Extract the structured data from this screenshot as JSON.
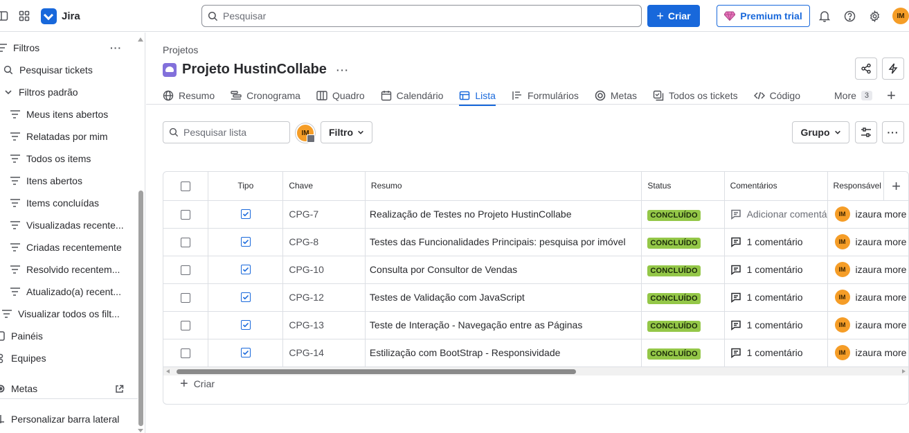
{
  "app": {
    "name": "Jira"
  },
  "topbar": {
    "search_placeholder": "Pesquisar",
    "create_label": "Criar",
    "premium_label": "Premium trial",
    "avatar_initials": "IM"
  },
  "sidebar": {
    "filters_label": "Filtros",
    "items": [
      {
        "label": "Pesquisar tickets",
        "icon": "search-icon"
      },
      {
        "label": "Filtros padrão",
        "icon": "chevron-down-icon"
      },
      {
        "label": "Meus itens abertos",
        "icon": "filter-icon"
      },
      {
        "label": "Relatadas por mim",
        "icon": "filter-icon"
      },
      {
        "label": "Todos os items",
        "icon": "filter-icon"
      },
      {
        "label": "Itens abertos",
        "icon": "filter-icon"
      },
      {
        "label": "Items concluídas",
        "icon": "filter-icon"
      },
      {
        "label": "Visualizadas recente...",
        "icon": "filter-icon"
      },
      {
        "label": "Criadas recentemente",
        "icon": "filter-icon"
      },
      {
        "label": "Resolvido recentem...",
        "icon": "filter-icon"
      },
      {
        "label": "Atualizado(a) recent...",
        "icon": "filter-icon"
      },
      {
        "label": "Visualizar todos os filt...",
        "icon": "filter-icon"
      }
    ],
    "panels_label": "Painéis",
    "teams_label": "Equipes",
    "goals_label": "Metas",
    "customize_label": "Personalizar barra lateral"
  },
  "main": {
    "breadcrumb": "Projetos",
    "project_name": "Projeto HustinCollabe",
    "tabs": [
      {
        "label": "Resumo",
        "icon": "globe-icon"
      },
      {
        "label": "Cronograma",
        "icon": "timeline-icon"
      },
      {
        "label": "Quadro",
        "icon": "board-icon"
      },
      {
        "label": "Calendário",
        "icon": "calendar-icon"
      },
      {
        "label": "Lista",
        "icon": "list-icon",
        "active": true
      },
      {
        "label": "Formulários",
        "icon": "forms-icon"
      },
      {
        "label": "Metas",
        "icon": "goal-icon"
      },
      {
        "label": "Todos os tickets",
        "icon": "tickets-icon"
      },
      {
        "label": "Código",
        "icon": "code-icon"
      }
    ],
    "more_label": "More",
    "more_count": "3",
    "list_search_placeholder": "Pesquisar lista",
    "filter_label": "Filtro",
    "group_label": "Grupo",
    "create_label": "Criar"
  },
  "table": {
    "headers": {
      "type": "Tipo",
      "key": "Chave",
      "summary": "Resumo",
      "status": "Status",
      "comments": "Comentários",
      "assignee": "Responsável"
    },
    "rows": [
      {
        "key": "CPG-7",
        "summary": "Realização de Testes no Projeto HustinCollabe",
        "status": "CONCLUÍDO",
        "comment": "Adicionar comentá",
        "assignee": "izaura more",
        "initials": "IM",
        "empty_comment": true
      },
      {
        "key": "CPG-8",
        "summary": "Testes das Funcionalidades Principais: pesquisa por imóvel",
        "status": "CONCLUÍDO",
        "comment": "1 comentário",
        "assignee": "izaura more",
        "initials": "IM"
      },
      {
        "key": "CPG-10",
        "summary": "Consulta por Consultor de Vendas",
        "status": "CONCLUÍDO",
        "comment": "1 comentário",
        "assignee": "izaura more",
        "initials": "IM"
      },
      {
        "key": "CPG-12",
        "summary": "Testes de Validação com JavaScript",
        "status": "CONCLUÍDO",
        "comment": "1 comentário",
        "assignee": "izaura more",
        "initials": "IM"
      },
      {
        "key": "CPG-13",
        "summary": "Teste de Interação - Navegação entre as Páginas",
        "status": "CONCLUÍDO",
        "comment": "1 comentário",
        "assignee": "izaura more",
        "initials": "IM"
      },
      {
        "key": "CPG-14",
        "summary": "Estilização com BootStrap - Responsividade",
        "status": "CONCLUÍDO",
        "comment": "1 comentário",
        "assignee": "izaura more",
        "initials": "IM"
      }
    ]
  }
}
